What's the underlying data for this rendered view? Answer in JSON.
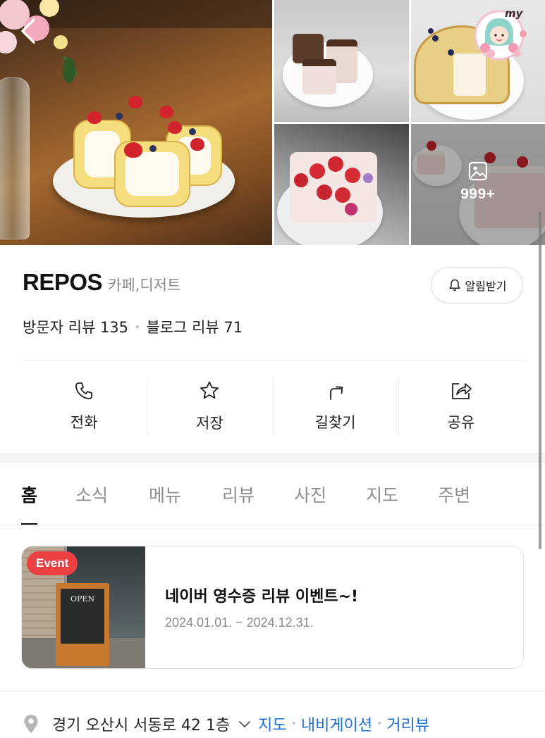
{
  "gallery": {
    "photo_count_label": "999+"
  },
  "place": {
    "name": "REPOS",
    "category": "카페,디저트",
    "notify_label": "알림받기",
    "visitor_reviews": "방문자 리뷰 135",
    "blog_reviews": "블로그 리뷰 71"
  },
  "actions": [
    {
      "label": "전화",
      "icon": "phone-icon"
    },
    {
      "label": "저장",
      "icon": "star-icon"
    },
    {
      "label": "길찾기",
      "icon": "directions-icon"
    },
    {
      "label": "공유",
      "icon": "share-icon"
    }
  ],
  "tabs": [
    {
      "label": "홈",
      "active": true
    },
    {
      "label": "소식"
    },
    {
      "label": "메뉴"
    },
    {
      "label": "리뷰"
    },
    {
      "label": "사진"
    },
    {
      "label": "지도"
    },
    {
      "label": "주변"
    }
  ],
  "event": {
    "badge": "Event",
    "title": "네이버 영수증 리뷰 이벤트~!",
    "date": "2024.01.01. ~ 2024.12.31.",
    "sign_text": "OPEN"
  },
  "address": {
    "text": "경기 오산시 서동로 42 1층",
    "map_link": "지도",
    "navigation_link": "내비게이션",
    "street_view_link": "거리뷰"
  },
  "badge": {
    "text": "my"
  },
  "colors": {
    "link_blue": "#1d6fd8",
    "event_red": "#ee3f45"
  }
}
